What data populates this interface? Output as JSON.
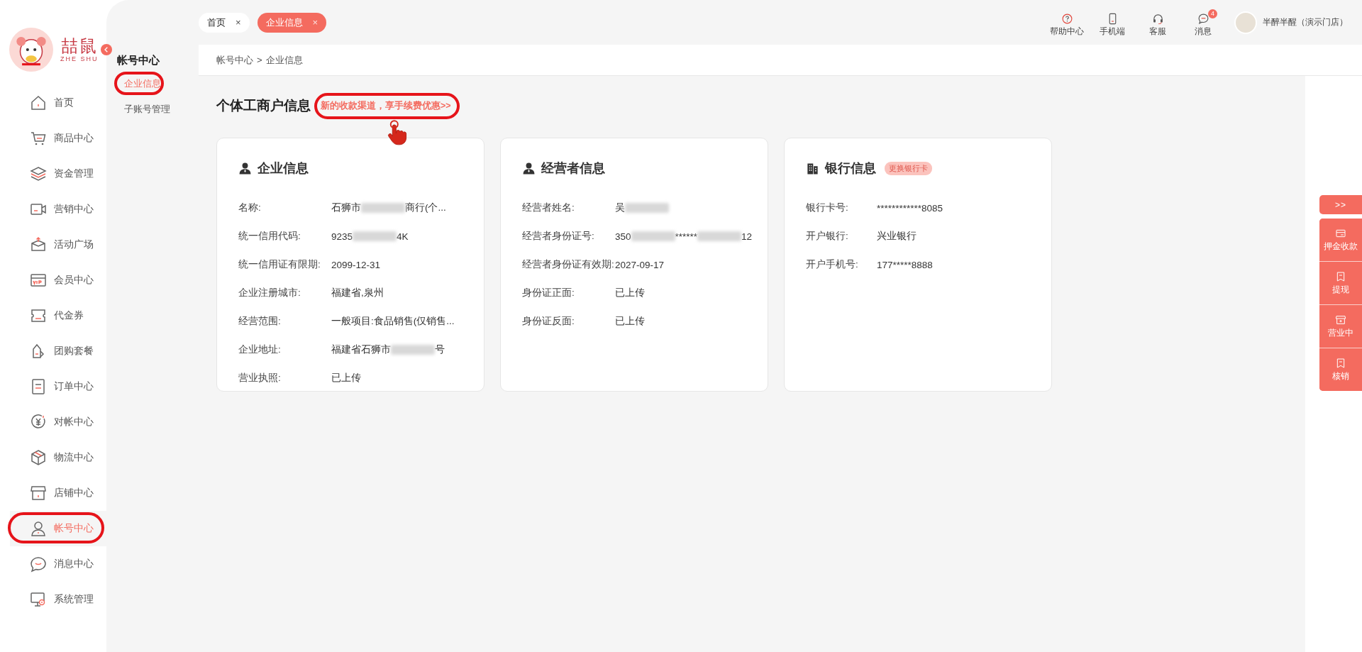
{
  "logo": {
    "name": "喆鼠",
    "subtitle": "ZHE SHU"
  },
  "sidebar": {
    "items": [
      {
        "label": "首页",
        "selected": false,
        "highlighted": false
      },
      {
        "label": "商品中心",
        "selected": false,
        "highlighted": false
      },
      {
        "label": "资金管理",
        "selected": false,
        "highlighted": false
      },
      {
        "label": "营销中心",
        "selected": false,
        "highlighted": false
      },
      {
        "label": "活动广场",
        "selected": false,
        "highlighted": false
      },
      {
        "label": "会员中心",
        "selected": false,
        "highlighted": false
      },
      {
        "label": "代金券",
        "selected": false,
        "highlighted": false
      },
      {
        "label": "团购套餐",
        "selected": false,
        "highlighted": false
      },
      {
        "label": "订单中心",
        "selected": false,
        "highlighted": false
      },
      {
        "label": "对帐中心",
        "selected": false,
        "highlighted": false
      },
      {
        "label": "物流中心",
        "selected": false,
        "highlighted": false
      },
      {
        "label": "店铺中心",
        "selected": false,
        "highlighted": false
      },
      {
        "label": "帐号中心",
        "selected": true,
        "highlighted": true
      },
      {
        "label": "消息中心",
        "selected": false,
        "highlighted": false
      },
      {
        "label": "系统管理",
        "selected": false,
        "highlighted": false
      }
    ]
  },
  "submenu": {
    "title": "帐号中心",
    "items": [
      {
        "label": "企业信息",
        "selected": true,
        "highlighted": true
      },
      {
        "label": "子账号管理",
        "selected": false,
        "highlighted": false
      }
    ]
  },
  "tabs": [
    {
      "label": "首页",
      "selected": false,
      "close": "×"
    },
    {
      "label": "企业信息",
      "selected": true,
      "close": "×"
    }
  ],
  "toolbar": [
    {
      "label": "帮助中心"
    },
    {
      "label": "手机端"
    },
    {
      "label": "客服"
    },
    {
      "label": "消息",
      "badge": "4"
    }
  ],
  "user": {
    "name": "半醉半醒（演示门店）"
  },
  "breadcrumb": {
    "items": [
      "帐号中心",
      "企业信息"
    ],
    "separator": ">"
  },
  "page_title": "个体工商户信息",
  "promo_link": {
    "text": "新的收款渠道，享手续费优惠>>",
    "highlighted": true
  },
  "cards": [
    {
      "title": "企业信息",
      "rows": [
        {
          "label": "名称:",
          "value": [
            {
              "kind": "text",
              "text": "石狮市"
            },
            {
              "kind": "blur"
            },
            {
              "kind": "text",
              "text": "商行(个..."
            }
          ]
        },
        {
          "label": "统一信用代码:",
          "value": [
            {
              "kind": "text",
              "text": "9235"
            },
            {
              "kind": "blur"
            },
            {
              "kind": "text",
              "text": "4K"
            }
          ]
        },
        {
          "label": "统一信用证有限期:",
          "value": [
            {
              "kind": "text",
              "text": "2099-12-31"
            }
          ]
        },
        {
          "label": "企业注册城市:",
          "value": [
            {
              "kind": "text",
              "text": "福建省,泉州"
            }
          ]
        },
        {
          "label": "经营范围:",
          "value": [
            {
              "kind": "text",
              "text": "一般项目:食品销售(仅销售..."
            }
          ]
        },
        {
          "label": "企业地址:",
          "value": [
            {
              "kind": "text",
              "text": "福建省石狮市"
            },
            {
              "kind": "blur"
            },
            {
              "kind": "text",
              "text": "号"
            }
          ]
        },
        {
          "label": "营业执照:",
          "value": [
            {
              "kind": "text",
              "text": "已上传"
            }
          ]
        }
      ]
    },
    {
      "title": "经营者信息",
      "rows": [
        {
          "label": "经营者姓名:",
          "value": [
            {
              "kind": "text",
              "text": "吴"
            },
            {
              "kind": "blur"
            }
          ]
        },
        {
          "label": "经营者身份证号:",
          "value": [
            {
              "kind": "text",
              "text": "350"
            },
            {
              "kind": "blur"
            },
            {
              "kind": "text",
              "text": "******"
            },
            {
              "kind": "blur"
            },
            {
              "kind": "text",
              "text": "12"
            }
          ]
        },
        {
          "label": "经营者身份证有效期:",
          "value": [
            {
              "kind": "text",
              "text": "2027-09-17"
            }
          ]
        },
        {
          "label": "身份证正面:",
          "value": [
            {
              "kind": "text",
              "text": "已上传"
            }
          ]
        },
        {
          "label": "身份证反面:",
          "value": [
            {
              "kind": "text",
              "text": "已上传"
            }
          ]
        }
      ]
    },
    {
      "title": "银行信息",
      "action": "更换银行卡",
      "rows": [
        {
          "label": "银行卡号:",
          "value": [
            {
              "kind": "text",
              "text": "************8085"
            }
          ]
        },
        {
          "label": "开户银行:",
          "value": [
            {
              "kind": "text",
              "text": "兴业银行"
            }
          ]
        },
        {
          "label": "开户手机号:",
          "value": [
            {
              "kind": "text",
              "text": "177*****8888"
            }
          ]
        }
      ]
    }
  ],
  "side_actions": [
    {
      "kind": "toggle",
      "label": ">>"
    },
    {
      "kind": "action",
      "label": "押金收款"
    },
    {
      "kind": "action",
      "label": "提现"
    },
    {
      "kind": "action",
      "label": "营业中"
    },
    {
      "kind": "action",
      "label": "核销"
    }
  ]
}
